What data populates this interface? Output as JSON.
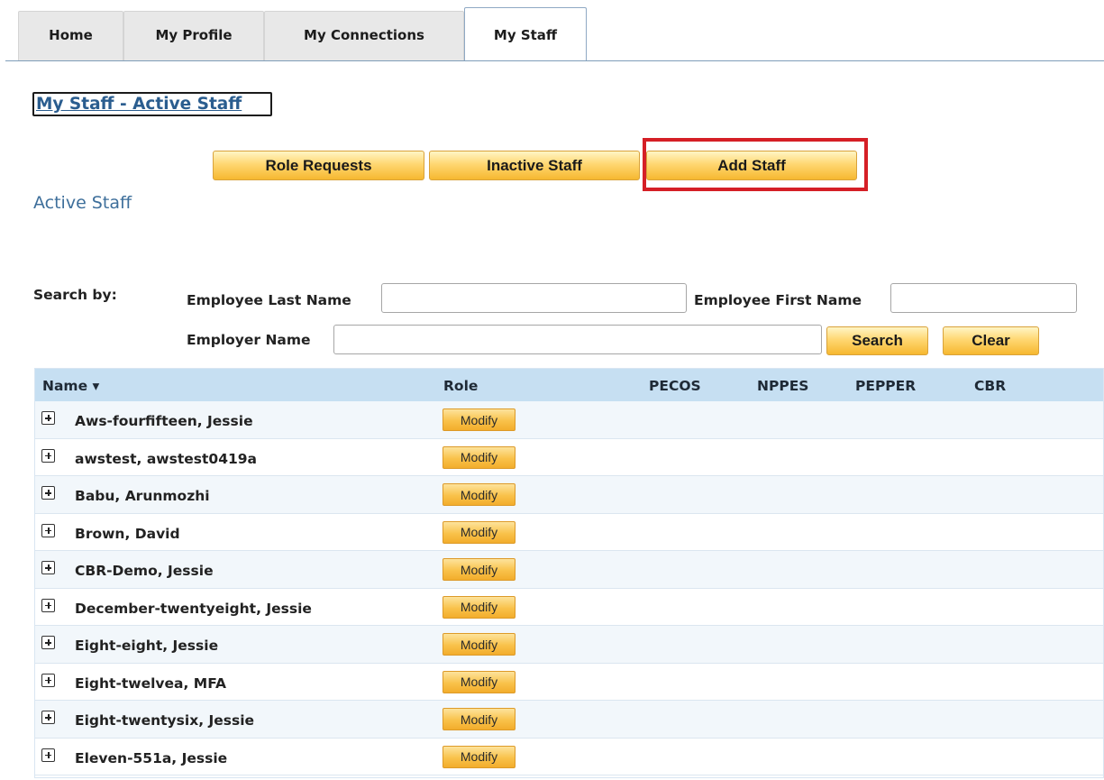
{
  "tabs": [
    {
      "label": "Home"
    },
    {
      "label": "My Profile"
    },
    {
      "label": "My Connections"
    },
    {
      "label": "My Staff"
    }
  ],
  "page_title": "My Staff - Active Staff",
  "action_buttons": {
    "role_requests": "Role Requests",
    "inactive_staff": "Inactive Staff",
    "add_staff": "Add Staff"
  },
  "section_title": "Active Staff",
  "search": {
    "search_by_label": "Search by:",
    "last_name_label": "Employee Last Name",
    "last_name_value": "",
    "first_name_label": "Employee First Name",
    "first_name_value": "",
    "employer_label": "Employer Name",
    "employer_value": "",
    "search_button": "Search",
    "clear_button": "Clear"
  },
  "table": {
    "columns": {
      "name": "Name ▾",
      "role": "Role",
      "pecos": "PECOS",
      "nppes": "NPPES",
      "pepper": "PEPPER",
      "cbr": "CBR"
    },
    "modify_label": "Modify",
    "rows": [
      {
        "name": "Aws-fourfifteen, Jessie"
      },
      {
        "name": "awstest, awstest0419a"
      },
      {
        "name": "Babu, Arunmozhi"
      },
      {
        "name": "Brown, David"
      },
      {
        "name": "CBR-Demo, Jessie"
      },
      {
        "name": "December-twentyeight, Jessie"
      },
      {
        "name": "Eight-eight, Jessie"
      },
      {
        "name": "Eight-twelvea, MFA"
      },
      {
        "name": "Eight-twentysix, Jessie"
      },
      {
        "name": "Eleven-551a, Jessie"
      }
    ]
  },
  "colors": {
    "highlight_border": "#d51f26",
    "table_header_bg": "#c6dff2",
    "heading_link": "#2a5d8f",
    "button_orange": "#f6b830"
  }
}
